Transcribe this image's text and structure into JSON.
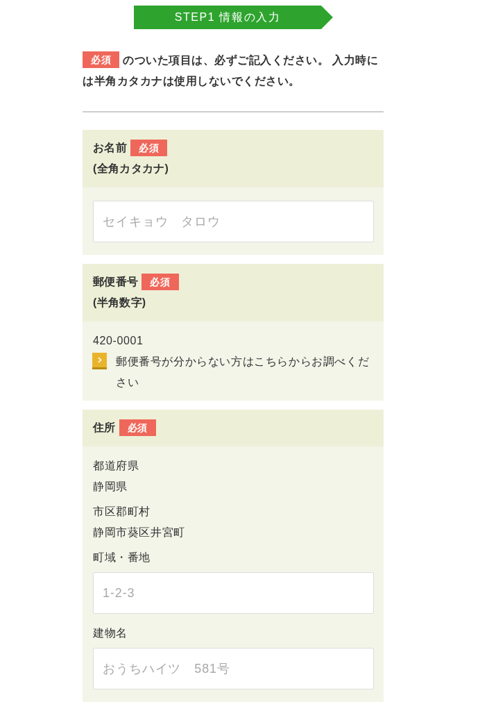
{
  "step_banner": {
    "label": "STEP1 情報の入力"
  },
  "notice": {
    "badge": "必須",
    "text": "のついた項目は、必ずご記入ください。 入力時には半角カタカナは使用しないでください。"
  },
  "sections": [
    {
      "label": "お名前",
      "badge": "必須",
      "note": "(全角カタカナ)",
      "items": [
        {
          "kind": "input",
          "placeholder": "セイキョウ　タロウ"
        }
      ]
    },
    {
      "label": "郵便番号",
      "badge": "必須",
      "note": "(半角数字)",
      "items": [
        {
          "kind": "text",
          "value": "420-0001"
        },
        {
          "kind": "link",
          "label": "郵便番号が分からない方はこちらからお調べください"
        }
      ]
    },
    {
      "label": "住所",
      "badge": "必須",
      "items": [
        {
          "kind": "display",
          "label": "都道府県",
          "value": "静岡県"
        },
        {
          "kind": "display",
          "label": "市区郡町村",
          "value": "静岡市葵区井宮町"
        },
        {
          "kind": "input",
          "label": "町域・番地",
          "placeholder": "1-2-3"
        },
        {
          "kind": "input",
          "label": "建物名",
          "placeholder": "おうちハイツ　581号"
        }
      ]
    }
  ]
}
